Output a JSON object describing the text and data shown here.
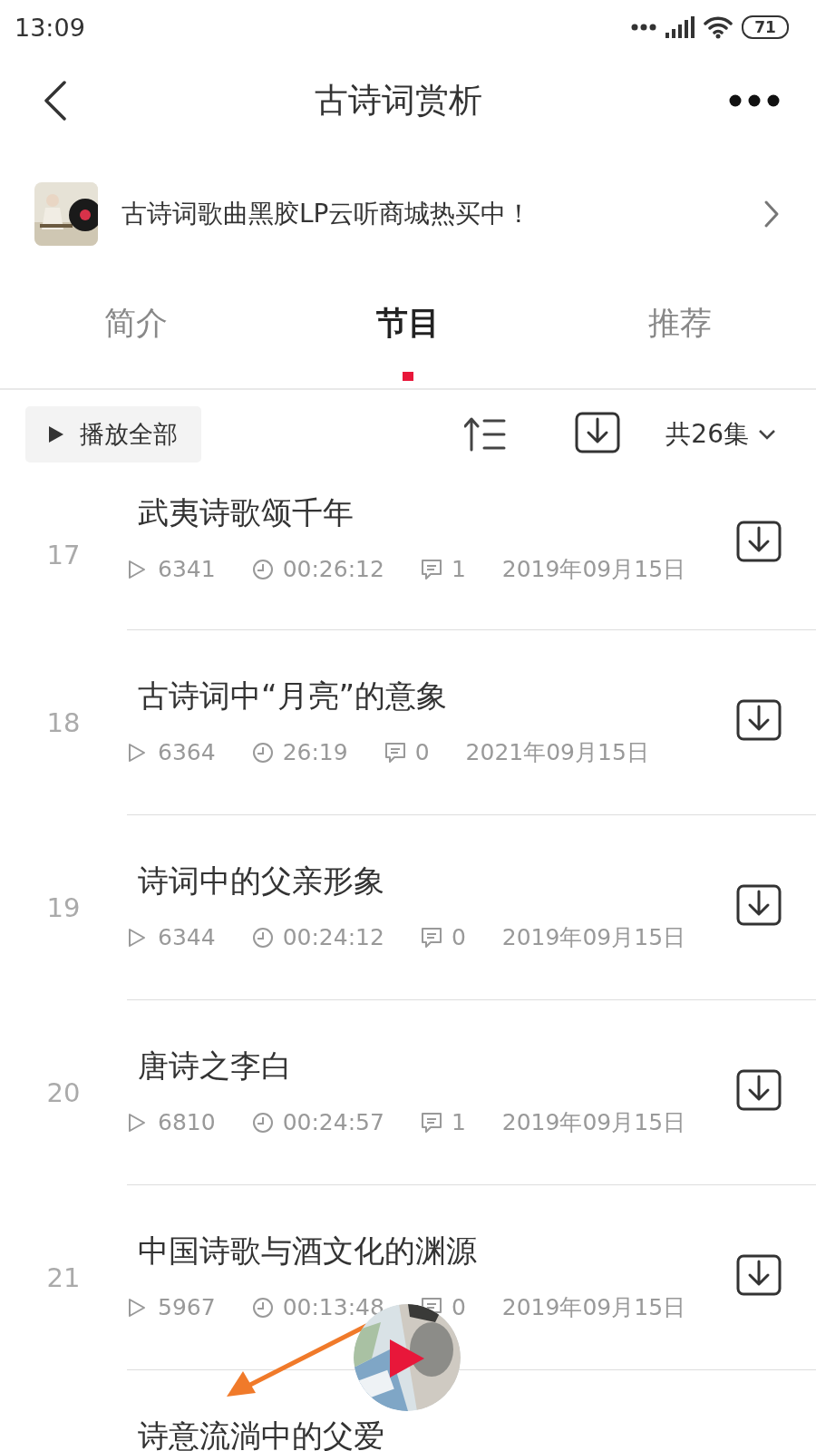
{
  "status_bar": {
    "time": "13:09",
    "battery": "71"
  },
  "header": {
    "title": "古诗词赏析"
  },
  "banner": {
    "text": "古诗词歌曲黑胶LP云听商城热买中！"
  },
  "tabs": [
    {
      "label": "简介",
      "selected": false
    },
    {
      "label": "节目",
      "selected": true
    },
    {
      "label": "推荐",
      "selected": false
    }
  ],
  "toolbar": {
    "play_all": "播放全部",
    "count": "共26集"
  },
  "episodes": [
    {
      "number": "17",
      "title": "武夷诗歌颂千年",
      "plays": "6341",
      "duration": "00:26:12",
      "comments": "1",
      "date": "2019年09月15日"
    },
    {
      "number": "18",
      "title": "古诗词中“月亮”的意象",
      "plays": "6364",
      "duration": "26:19",
      "comments": "0",
      "date": "2021年09月15日"
    },
    {
      "number": "19",
      "title": "诗词中的父亲形象",
      "plays": "6344",
      "duration": "00:24:12",
      "comments": "0",
      "date": "2019年09月15日"
    },
    {
      "number": "20",
      "title": "唐诗之李白",
      "plays": "6810",
      "duration": "00:24:57",
      "comments": "1",
      "date": "2019年09月15日"
    },
    {
      "number": "21",
      "title": "中国诗歌与酒文化的渊源",
      "plays": "5967",
      "duration": "00:13:48",
      "comments": "0",
      "date": "2019年09月15日"
    },
    {
      "title": "诗意流淌中的父爱"
    }
  ]
}
